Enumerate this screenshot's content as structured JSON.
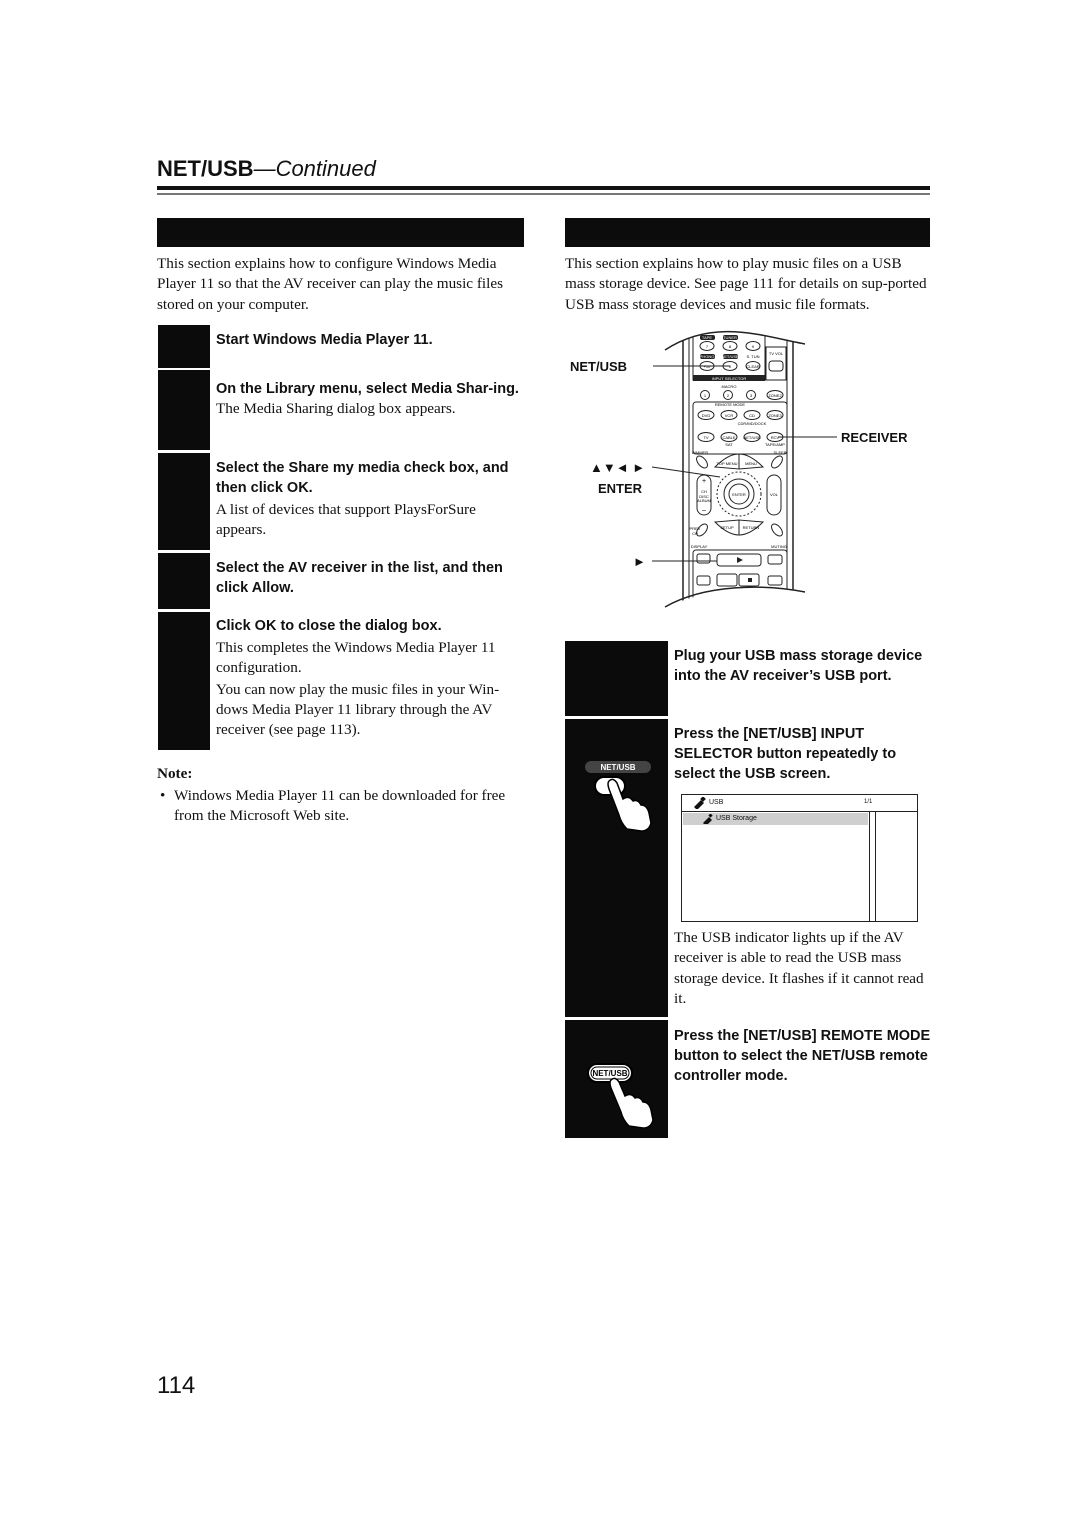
{
  "header": {
    "title_bold": "NET/USB",
    "title_italic": "—Continued"
  },
  "left_section": {
    "intro": "This section explains how to configure Windows Media Player 11 so that the AV receiver can play the music files stored on your computer.",
    "steps": [
      {
        "title": "Start Windows Media Player 11.",
        "desc": ""
      },
      {
        "title": "On the Library menu, select Media Shar-ing.",
        "desc": "The Media Sharing dialog box appears."
      },
      {
        "title": "Select the Share my media check box, and then click OK.",
        "desc": "A list of devices that support PlaysForSure appears."
      },
      {
        "title": "Select the AV receiver in the list, and then click Allow.",
        "desc": ""
      },
      {
        "title": "Click OK to close the dialog box.",
        "desc": "This completes the Windows Media Player 11 configuration.",
        "desc2": "You can now play the music files in your Win-dows Media Player 11 library through the AV receiver (see page 113)."
      }
    ],
    "note_label": "Note:",
    "note_items": [
      "Windows Media Player 11 can be downloaded for free from the Microsoft Web site."
    ]
  },
  "right_section": {
    "intro": "This section explains how to play music files on a USB mass storage device. See page 111 for details on sup-ported USB mass storage devices and music file formats.",
    "remote_callouts": {
      "net_usb": "NET/USB",
      "receiver": "RECEIVER",
      "arrows": "▲▼◄ ►",
      "enter": "ENTER",
      "play": "►"
    },
    "remote_labels": {
      "tape": "TAPE",
      "tuner": "TUNER",
      "phono": "PHONO",
      "netusb": "NET/USB",
      "stun": "S. TUN",
      "tvvol": "TV VOL",
      "b7": "7",
      "b8": "8",
      "b9": "9",
      "b0": "0",
      "clear": "CLEAR",
      "input_selector": "INPUT SELECTOR",
      "macro": "MACRO",
      "m1": "1",
      "m2": "2",
      "m3": "3",
      "zone2": "ZONE2",
      "remote_mode": "REMOTE MODE",
      "dvd": "DVD",
      "vcr": "VCR",
      "cd": "CD",
      "cdr": "CDR/MD/DOCK",
      "zone3": "ZONE3",
      "tv": "TV",
      "cable": "CABLE",
      "sat": "SAT",
      "netusb2": "NET/USB",
      "rcv": "RCV",
      "tapeamp": "TAPE/AMP",
      "dimmer": "DIMMER",
      "sleep": "SLEEP",
      "topmenu": "TOP MENU",
      "menu": "MENU",
      "ch": "CH",
      "disc": "DISC",
      "album": "ALBUM",
      "enter": "ENTER",
      "vol": "VOL",
      "prevch": "PREV CH",
      "setup": "SETUP",
      "return": "RETURN",
      "display": "DISPLAY",
      "muting": "MUTING",
      "random": "RANDOM"
    },
    "steps": [
      {
        "title": "Plug your USB mass storage device into the AV receiver’s USB port.",
        "button_label": ""
      },
      {
        "title": "Press the [NET/USB] INPUT SELECTOR button repeatedly to select the USB screen.",
        "button_label": "NET/USB",
        "desc": "The USB indicator lights up if the AV receiver is able to read the USB mass storage device. It flashes if it cannot read it."
      },
      {
        "title": "Press the [NET/USB] REMOTE MODE button to select the NET/USB remote controller mode.",
        "button_label": "NET/USB"
      }
    ],
    "usb_screen": {
      "header_label": "USB",
      "page_indicator": "1/1",
      "items": [
        "USB Storage"
      ]
    }
  },
  "footer": {
    "page_number": "114"
  }
}
